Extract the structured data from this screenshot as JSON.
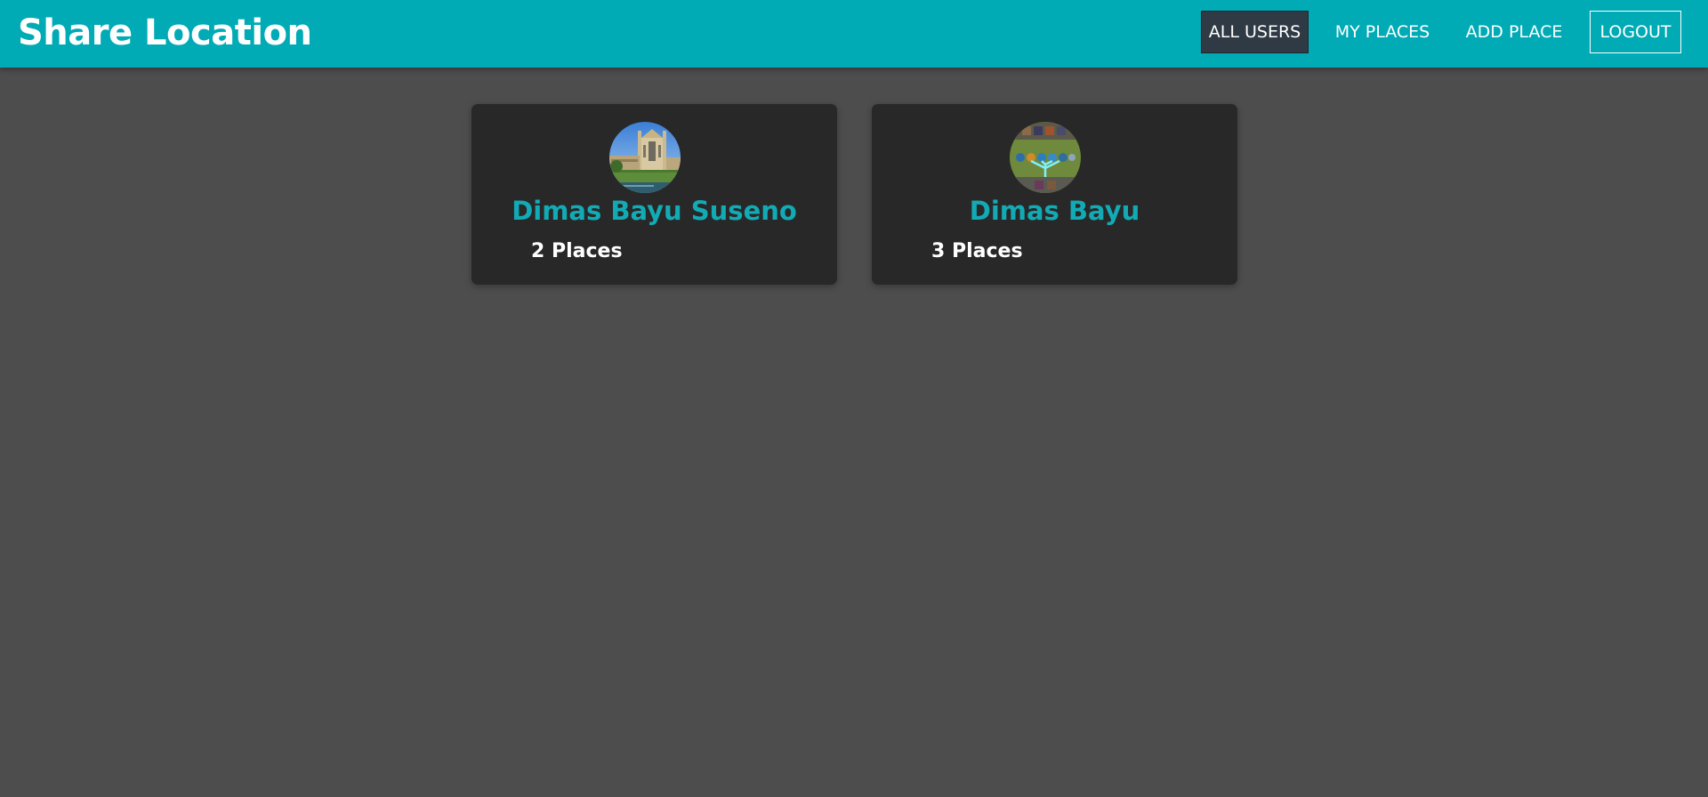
{
  "header": {
    "title": "Share Location",
    "background_color": "#00abb6"
  },
  "nav": {
    "all_users": "ALL USERS",
    "my_places": "MY PLACES",
    "add_place": "ADD PLACE",
    "logout": "LOGOUT",
    "active_item": "all_users"
  },
  "users": [
    {
      "name": "Dimas Bayu Suseno",
      "places": "2 Places",
      "avatar_subject": "college chapel building photo"
    },
    {
      "name": "Dimas Bayu",
      "places": "3 Places",
      "avatar_subject": "game skill tree screenshot"
    }
  ],
  "colors": {
    "page_background": "#4d4d4d",
    "card_background": "#282828",
    "accent": "#12abb5",
    "active_nav": "#2f3a45"
  }
}
